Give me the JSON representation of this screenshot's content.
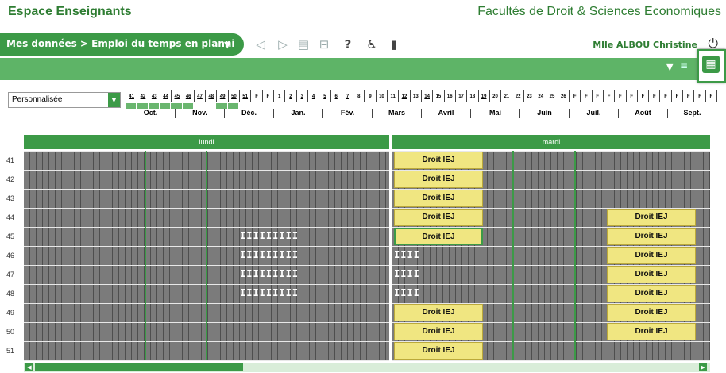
{
  "header": {
    "brand": "Espace Enseignants",
    "faculty": "Facultés de Droit & Sciences Economiques"
  },
  "nav": {
    "breadcrumb": "Mes données > Emploi du temps en planni",
    "user": "Mlle ALBOU Christine",
    "icons": [
      "chevron-down-icon",
      "triangle-left-icon",
      "triangle-right-icon",
      "document-icon",
      "print-icon",
      "help-icon",
      "accessibility-icon",
      "mobile-icon",
      "power-icon"
    ]
  },
  "filter": {
    "selected": "Personnalisée"
  },
  "weeks": {
    "items": [
      {
        "label": "41",
        "u": true
      },
      {
        "label": "42",
        "u": true
      },
      {
        "label": "43",
        "u": true
      },
      {
        "label": "44",
        "u": true
      },
      {
        "label": "45",
        "u": true
      },
      {
        "label": "46",
        "u": true
      },
      {
        "label": "47",
        "u": true
      },
      {
        "label": "48",
        "u": true
      },
      {
        "label": "49",
        "u": true
      },
      {
        "label": "50",
        "u": true
      },
      {
        "label": "51",
        "u": true
      },
      {
        "label": "F",
        "u": false
      },
      {
        "label": "F",
        "u": false
      },
      {
        "label": "1",
        "u": false
      },
      {
        "label": "2",
        "u": true
      },
      {
        "label": "3",
        "u": true
      },
      {
        "label": "4",
        "u": true
      },
      {
        "label": "5",
        "u": true
      },
      {
        "label": "6",
        "u": true
      },
      {
        "label": "7",
        "u": true
      },
      {
        "label": "8",
        "u": false
      },
      {
        "label": "9",
        "u": false
      },
      {
        "label": "10",
        "u": false
      },
      {
        "label": "11",
        "u": false
      },
      {
        "label": "12",
        "u": true
      },
      {
        "label": "13",
        "u": false
      },
      {
        "label": "14",
        "u": true
      },
      {
        "label": "15",
        "u": false
      },
      {
        "label": "16",
        "u": false
      },
      {
        "label": "17",
        "u": false
      },
      {
        "label": "18",
        "u": false
      },
      {
        "label": "19",
        "u": true
      },
      {
        "label": "20",
        "u": false
      },
      {
        "label": "21",
        "u": false
      },
      {
        "label": "22",
        "u": false
      },
      {
        "label": "23",
        "u": false
      },
      {
        "label": "24",
        "u": false
      },
      {
        "label": "25",
        "u": false
      },
      {
        "label": "26",
        "u": false
      },
      {
        "label": "F",
        "u": false
      },
      {
        "label": "F",
        "u": false
      },
      {
        "label": "F",
        "u": false
      },
      {
        "label": "F",
        "u": false
      },
      {
        "label": "F",
        "u": false
      },
      {
        "label": "F",
        "u": false
      },
      {
        "label": "F",
        "u": false
      },
      {
        "label": "F",
        "u": false
      },
      {
        "label": "F",
        "u": false
      },
      {
        "label": "F",
        "u": false
      },
      {
        "label": "F",
        "u": false
      },
      {
        "label": "F",
        "u": false
      },
      {
        "label": "F",
        "u": false
      }
    ],
    "months": [
      "Oct.",
      "Nov.",
      "Déc.",
      "Jan.",
      "Fév.",
      "Mars",
      "Avril",
      "Mai",
      "Juin",
      "Juil.",
      "Août",
      "Sept."
    ]
  },
  "days": [
    "lundi",
    "mardi"
  ],
  "rows": [
    "41",
    "42",
    "43",
    "44",
    "45",
    "46",
    "47",
    "48",
    "49",
    "50",
    "51"
  ],
  "course_label": "Droit IEJ",
  "tick_mark": "IIIIIIIII",
  "tick_mark_short": "IIII",
  "colors": {
    "accent": "#3c9a47",
    "course": "#f0e681",
    "grid": "#7b7b7b"
  }
}
